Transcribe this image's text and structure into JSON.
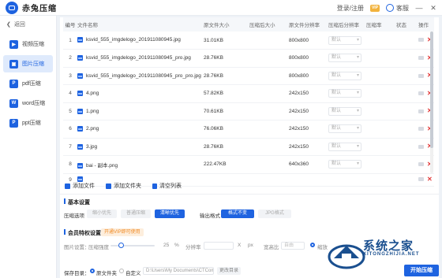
{
  "app": {
    "title": "赤兔压缩",
    "login": "登录/注册",
    "vip": "VIP",
    "service": "客服",
    "min": "—",
    "close": "✕"
  },
  "sidebar": {
    "back": "返回",
    "items": [
      {
        "label": "视频压缩",
        "icon": "video-icon"
      },
      {
        "label": "图片压缩",
        "icon": "image-icon",
        "active": true
      },
      {
        "label": "pdf压缩",
        "icon": "pdf-icon"
      },
      {
        "label": "word压缩",
        "icon": "word-icon"
      },
      {
        "label": "ppt压缩",
        "icon": "ppt-icon"
      }
    ]
  },
  "table": {
    "headers": [
      "编号",
      "文件名称",
      "原文件大小",
      "压缩后大小",
      "原文件分辨率",
      "压缩后分辨率",
      "压缩率",
      "状态",
      "操作"
    ],
    "select_default": "默认",
    "rows": [
      {
        "num": "1",
        "name": "ksvid_555_imgdelogo_201911080945.jpg",
        "orig": "31.01KB",
        "res": "800x800"
      },
      {
        "num": "2",
        "name": "ksvid_555_imgdelogo_201911080945_pro.jpg",
        "orig": "28.76KB",
        "res": "800x800"
      },
      {
        "num": "3",
        "name": "ksvid_555_imgdelogo_201911080945_pro_pro.jpg",
        "orig": "28.76KB",
        "res": "800x800"
      },
      {
        "num": "4",
        "name": "4.png",
        "orig": "57.82KB",
        "res": "242x150"
      },
      {
        "num": "5",
        "name": "1.png",
        "orig": "70.61KB",
        "res": "242x150"
      },
      {
        "num": "6",
        "name": "2.png",
        "orig": "76.06KB",
        "res": "242x150"
      },
      {
        "num": "7",
        "name": "3.jpg",
        "orig": "28.76KB",
        "res": "242x150"
      },
      {
        "num": "8",
        "name": "bai - 副本.png",
        "orig": "222.47KB",
        "res": "640x360"
      },
      {
        "num": "9",
        "name": "",
        "orig": "",
        "res": ""
      }
    ]
  },
  "actions": {
    "add_file": "添加文件",
    "add_folder": "添加文件夹",
    "clear": "清空列表"
  },
  "settings": {
    "basic_title": "基本设置",
    "compress_option_label": "压缩选项",
    "options": [
      "缩小优先",
      "普通压缩",
      "清晰优先"
    ],
    "output_label": "输出格式",
    "formats": [
      "格式不变",
      "JPG格式"
    ],
    "member_title": "会员特权设置",
    "member_tag": "开通VIP即可使用",
    "image_settings_label": "图片设置：",
    "strength_label": "压缩强度",
    "strength_value": "25",
    "percent": "%",
    "resolution_label": "分辨率",
    "x": "X",
    "px": "px",
    "ratio_label": "宽高比",
    "ratio_value": "自由",
    "keep_label": "缩放",
    "save_label": "保存目录：",
    "save_opt1": "原文件夹",
    "save_opt2": "自定义",
    "save_path": "D:\\Users\\My Documents\\CTComp",
    "change_dir": "更改目录",
    "start": "开始压缩"
  },
  "watermark": {
    "title": "系统之家",
    "sub": "XITONGZHIJIA.NET"
  },
  "colors": {
    "accent": "#1e63e0",
    "delete": "#e23b3b",
    "member": "#f08a24"
  }
}
